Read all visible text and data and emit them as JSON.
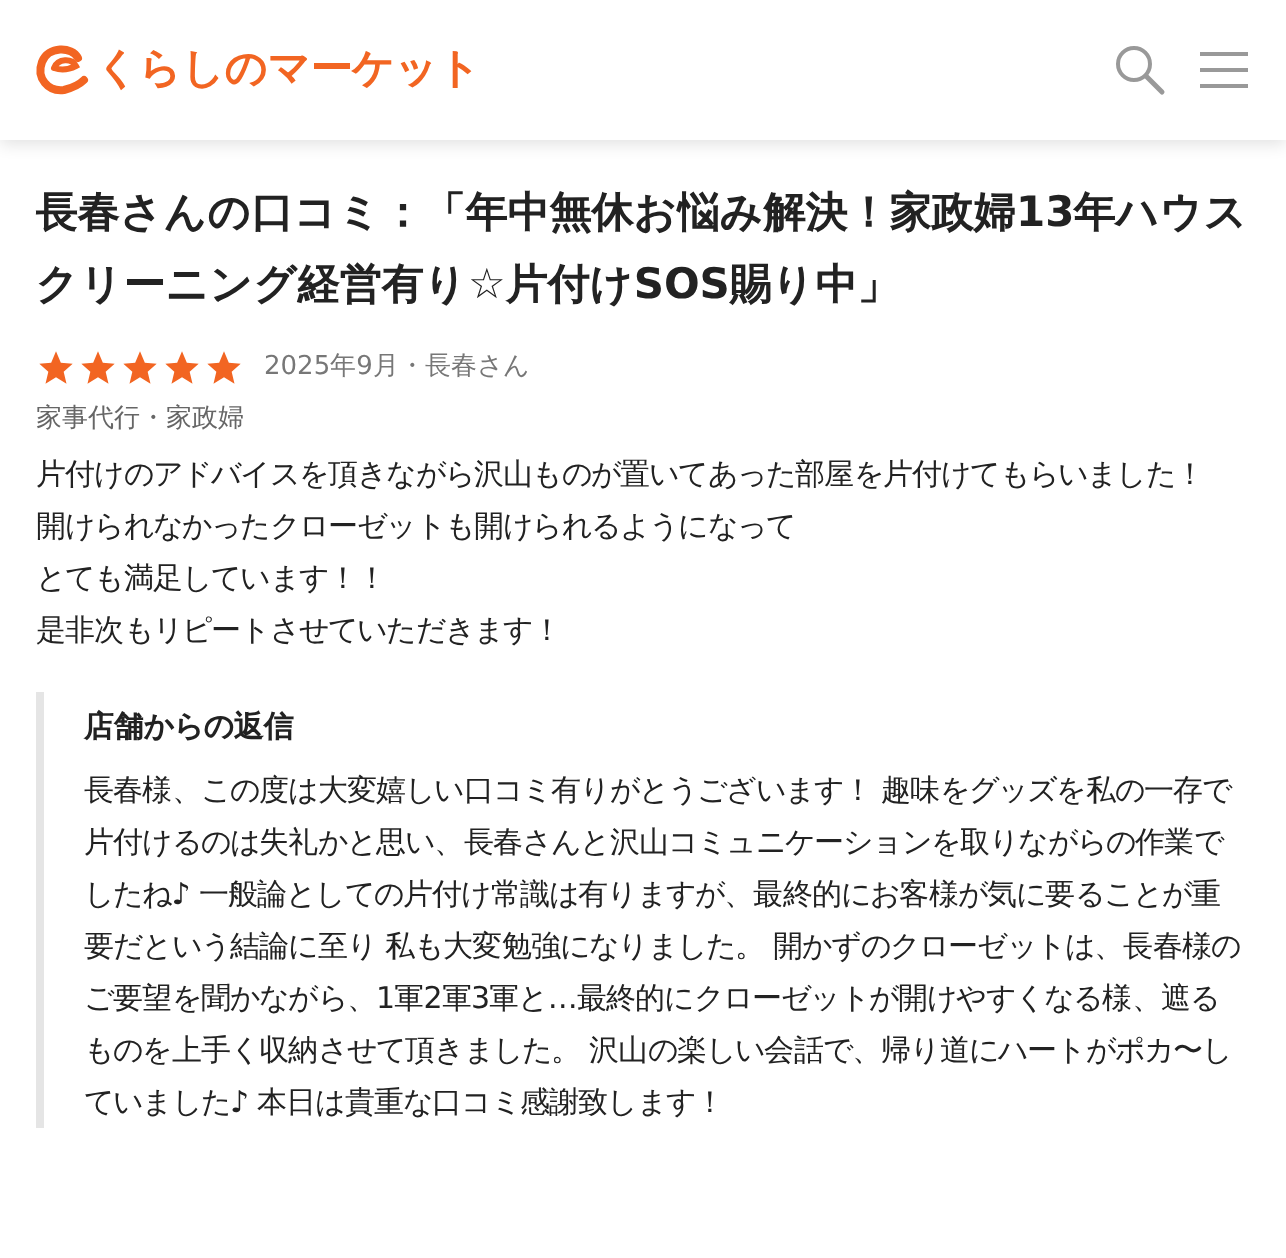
{
  "header": {
    "logo_text": "くらしのマーケット"
  },
  "review": {
    "title": "長春さんの口コミ：「年中無休お悩み解決！家政婦13年ハウスクリーニング経営有り☆片付けSOS賜り中」",
    "stars": 5,
    "meta": "2025年9月・長春さん",
    "category": "家事代行・家政婦",
    "body_lines": [
      "片付けのアドバイスを頂きながら沢山ものが置いてあった部屋を片付けてもらいました！",
      "開けられなかったクローゼットも開けられるようになって",
      "とても満足しています！！",
      "是非次もリピートさせていただきます！"
    ]
  },
  "reply": {
    "heading": "店舗からの返信",
    "text": "長春様、この度は大変嬉しい口コミ有りがとうございます！ 趣味をグッズを私の一存で片付けるのは失礼かと思い、長春さんと沢山コミュニケーションを取りながらの作業でしたね♪ 一般論としての片付け常識は有りますが、最終的にお客様が気に要ることが重要だという結論に至り 私も大変勉強になりました。 開かずのクローゼットは、長春様のご要望を聞かながら、1軍2軍3軍と…最終的にクローゼットが開けやすくなる様、遮るものを上手く収納させて頂きました。 沢山の楽しい会話で、帰り道にハートがポカ〜していました♪ 本日は貴重な口コミ感謝致します！"
  }
}
